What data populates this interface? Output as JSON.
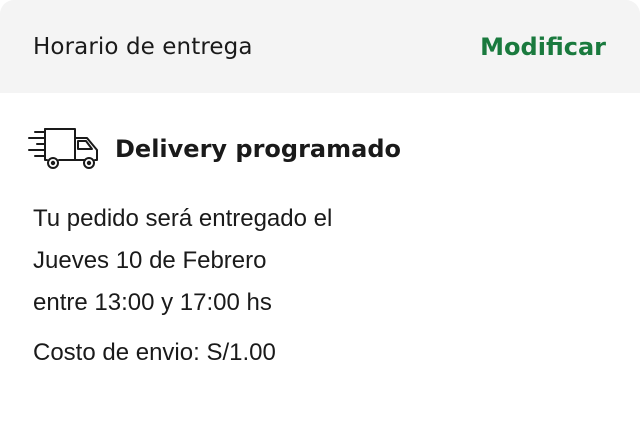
{
  "header": {
    "title": "Horario de entrega",
    "action_label": "Modificar"
  },
  "delivery": {
    "icon": "truck-fast-icon",
    "title": "Delivery programado",
    "line1": "Tu pedido será entregado el",
    "line2": "Jueves 10 de Febrero",
    "line3": "entre 13:00 y 17:00 hs",
    "cost": "Costo de envio: S/1.00"
  },
  "colors": {
    "accent": "#1a7a3e",
    "header_bg": "#f4f4f4",
    "text": "#1a1a1a"
  }
}
